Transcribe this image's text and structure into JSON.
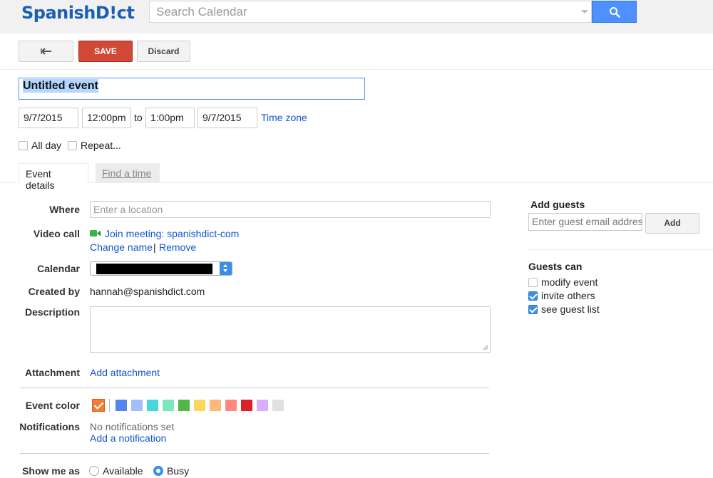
{
  "header": {
    "logo": "SpanishD!ct",
    "search_placeholder": "Search Calendar"
  },
  "toolbar": {
    "save_label": "SAVE",
    "discard_label": "Discard"
  },
  "event": {
    "title": "Untitled event",
    "start_date": "9/7/2015",
    "start_time": "12:00pm",
    "to_label": "to",
    "end_time": "1:00pm",
    "end_date": "9/7/2015",
    "time_zone_label": "Time zone",
    "all_day_label": "All day",
    "repeat_label": "Repeat..."
  },
  "tabs": {
    "event_details": "Event details",
    "find_time": "Find a time"
  },
  "form": {
    "where_label": "Where",
    "where_placeholder": "Enter a location",
    "video_call_label": "Video call",
    "join_meeting": "Join meeting: spanishdict-com",
    "change_name": "Change name",
    "separator": "|",
    "remove": "Remove",
    "calendar_label": "Calendar",
    "created_by_label": "Created by",
    "created_by_value": "hannah@spanishdict.com",
    "description_label": "Description",
    "attachment_label": "Attachment",
    "add_attachment": "Add attachment",
    "event_color_label": "Event color",
    "notifications_label": "Notifications",
    "no_notifications": "No notifications set",
    "add_notification": "Add a notification",
    "show_me_as_label": "Show me as",
    "available_label": "Available",
    "busy_label": "Busy"
  },
  "colors": {
    "selected": "#f07e38",
    "swatches": [
      "#5484ed",
      "#a4bdfc",
      "#46d6db",
      "#7ae7bf",
      "#51b749",
      "#fbd75b",
      "#ffb878",
      "#ff887c",
      "#dc2127",
      "#dbadff",
      "#e1e1e1"
    ]
  },
  "guests": {
    "add_guests_title": "Add guests",
    "email_placeholder": "Enter guest email addres",
    "add_button": "Add",
    "guests_can_title": "Guests can",
    "options": [
      {
        "label": "modify event",
        "checked": false
      },
      {
        "label": "invite others",
        "checked": true
      },
      {
        "label": "see guest list",
        "checked": true
      }
    ]
  }
}
